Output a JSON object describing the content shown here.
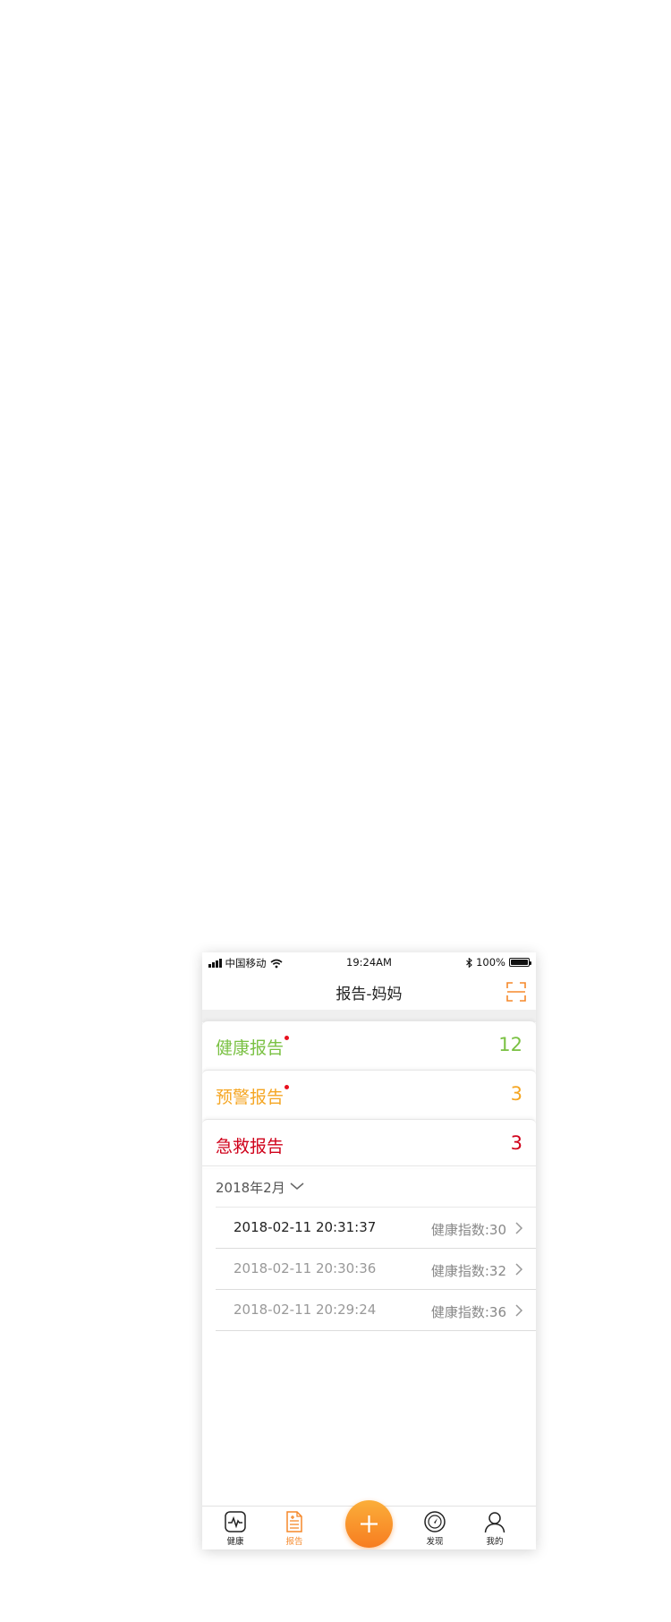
{
  "status_bar": {
    "carrier": "中国移动",
    "time": "19:24AM",
    "battery": "100%"
  },
  "nav": {
    "title": "报告-妈妈",
    "scan_icon": "scan-icon"
  },
  "report_cards": [
    {
      "label": "健康报告",
      "count": "12",
      "color": "#7ac143",
      "has_dot": true
    },
    {
      "label": "预警报告",
      "count": "3",
      "color": "#f5a623",
      "has_dot": true
    },
    {
      "label": "急救报告",
      "count": "3",
      "color": "#d0021b",
      "has_dot": false
    }
  ],
  "month_filter": {
    "label": "2018年2月"
  },
  "records": [
    {
      "timestamp": "2018-02-11 20:31:37",
      "index": "健康指数:30",
      "color": "#222222"
    },
    {
      "timestamp": "2018-02-11 20:30:36",
      "index": "健康指数:32",
      "color": "#999999"
    },
    {
      "timestamp": "2018-02-11 20:29:24",
      "index": "健康指数:36",
      "color": "#999999"
    }
  ],
  "tab_bar": {
    "tabs": [
      {
        "label": "健康",
        "icon": "heartbeat-icon"
      },
      {
        "label": "报告",
        "icon": "report-icon"
      },
      {
        "label": "发现",
        "icon": "compass-icon"
      },
      {
        "label": "我的",
        "icon": "user-icon"
      }
    ],
    "active": "报告",
    "accent": "#f5882a"
  }
}
